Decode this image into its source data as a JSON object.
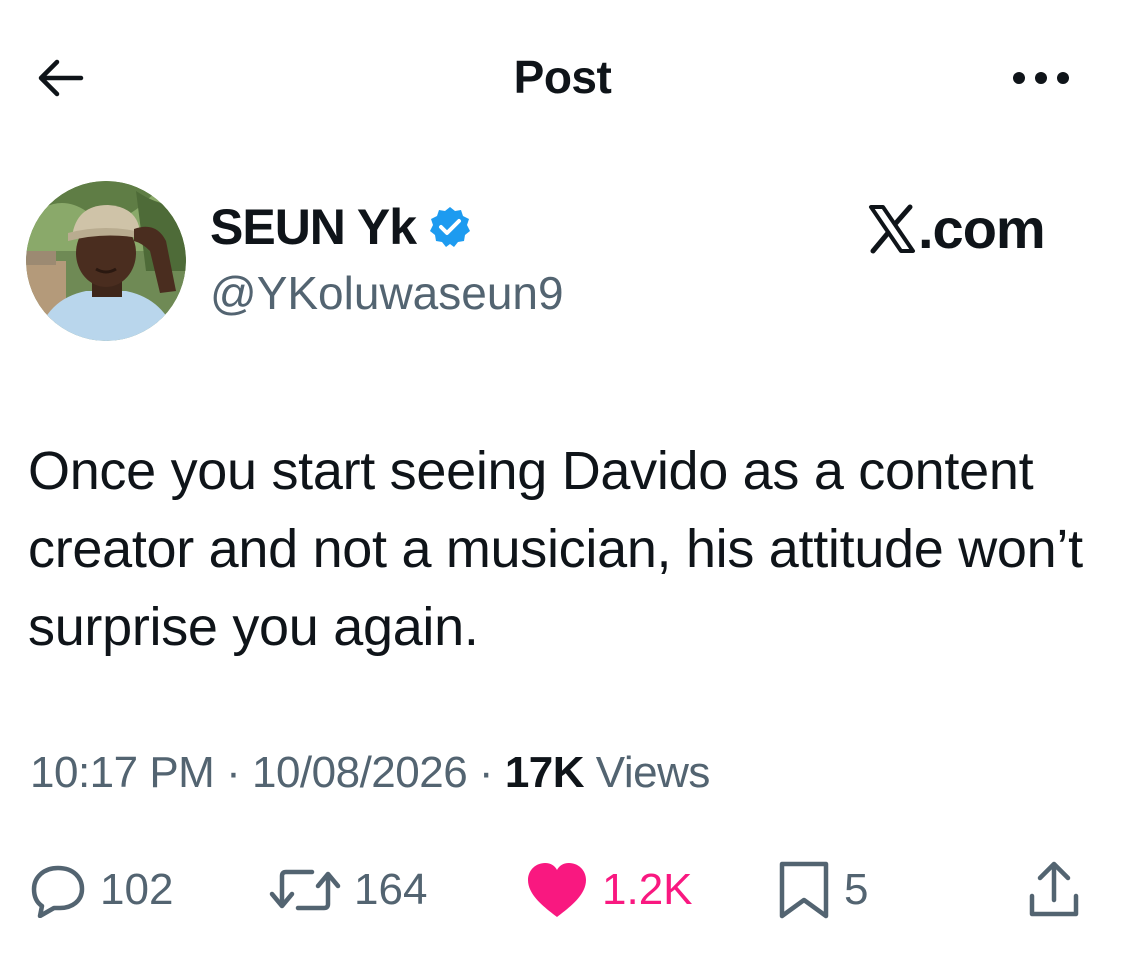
{
  "header": {
    "title": "Post",
    "back_icon": "arrow-left-icon",
    "more_icon": "more-horizontal-icon"
  },
  "author": {
    "display_name": "SEUN Yk",
    "handle": "@YKoluwaseun9",
    "verified": true,
    "verified_color": "#1d9bf0"
  },
  "brand": {
    "label": ".com",
    "icon": "x-logo-icon"
  },
  "post": {
    "text": "Once you start seeing Davido as a content creator and not a musician, his attitude won’t surprise you again."
  },
  "meta": {
    "time": "10:17 PM",
    "separator": "·",
    "date": "10/08/2026",
    "views_count": "17K",
    "views_label": "Views"
  },
  "actions": {
    "replies": {
      "icon": "reply-icon",
      "count": "102"
    },
    "reposts": {
      "icon": "repost-icon",
      "count": "164"
    },
    "likes": {
      "icon": "heart-icon",
      "count": "1.2K",
      "liked": true,
      "color": "#f91880"
    },
    "bookmarks": {
      "icon": "bookmark-icon",
      "count": "5"
    },
    "share": {
      "icon": "share-icon"
    }
  },
  "colors": {
    "text_primary": "#0f1419",
    "text_secondary": "#536471",
    "like": "#f91880",
    "verified": "#1d9bf0"
  }
}
